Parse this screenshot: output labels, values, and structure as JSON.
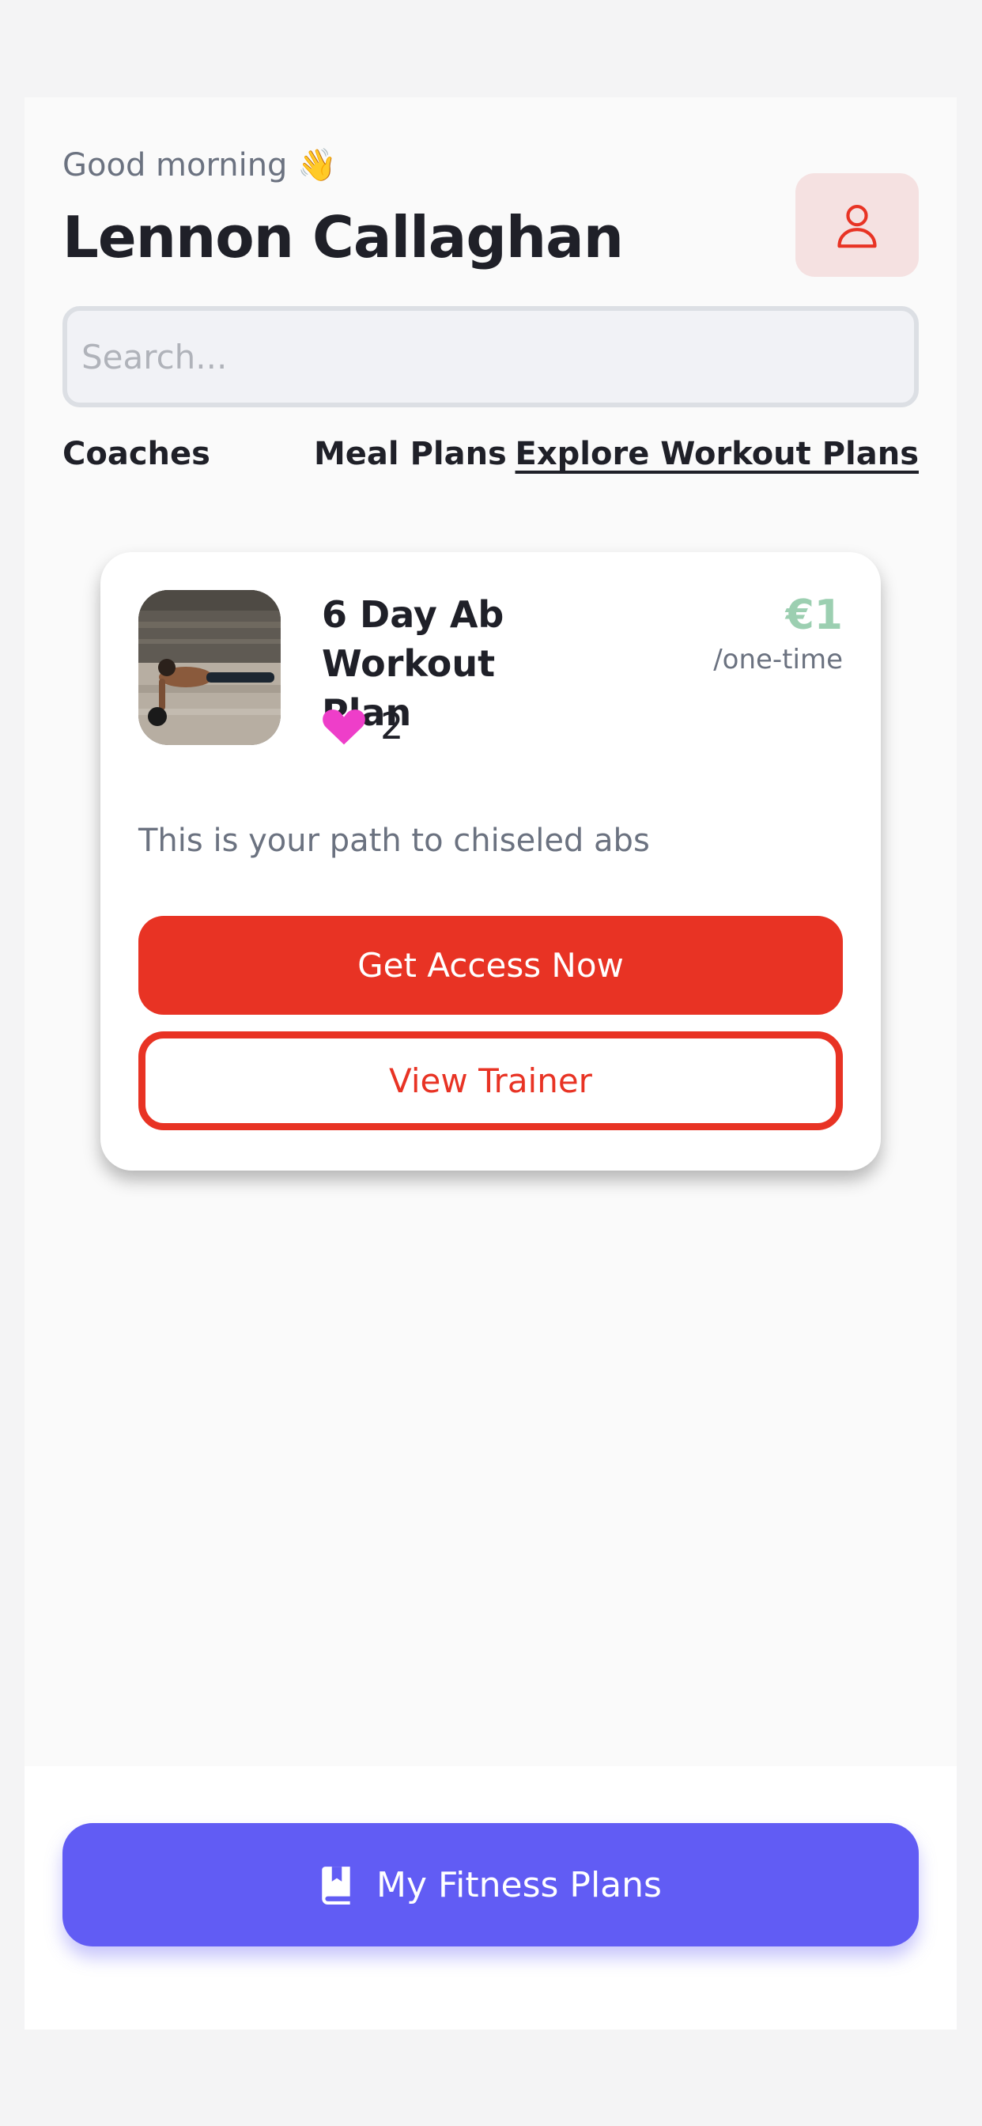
{
  "header": {
    "greeting": "Good morning 👋",
    "user_name": "Lennon Callaghan"
  },
  "search": {
    "placeholder": "Search..."
  },
  "tabs": [
    {
      "label": "Coaches",
      "active": false
    },
    {
      "label": "Meal Plans",
      "active": false
    },
    {
      "label": "Explore Workout Plans",
      "active": true
    }
  ],
  "plan_card": {
    "title": "6 Day Ab Workout Plan",
    "likes": "2",
    "price": "€1",
    "price_term": "/one-time",
    "description": "This is your path to chiseled abs",
    "primary_button": "Get Access Now",
    "secondary_button": "View Trainer"
  },
  "footer": {
    "plans_button": "My Fitness Plans"
  },
  "colors": {
    "accent_red": "#e83324",
    "primary_purple": "#615cf4",
    "price_green": "#9ccfb1",
    "heart_pink": "#ee3ec9"
  },
  "icons": {
    "profile": "user-icon",
    "like": "heart-icon",
    "plans": "book-icon"
  }
}
